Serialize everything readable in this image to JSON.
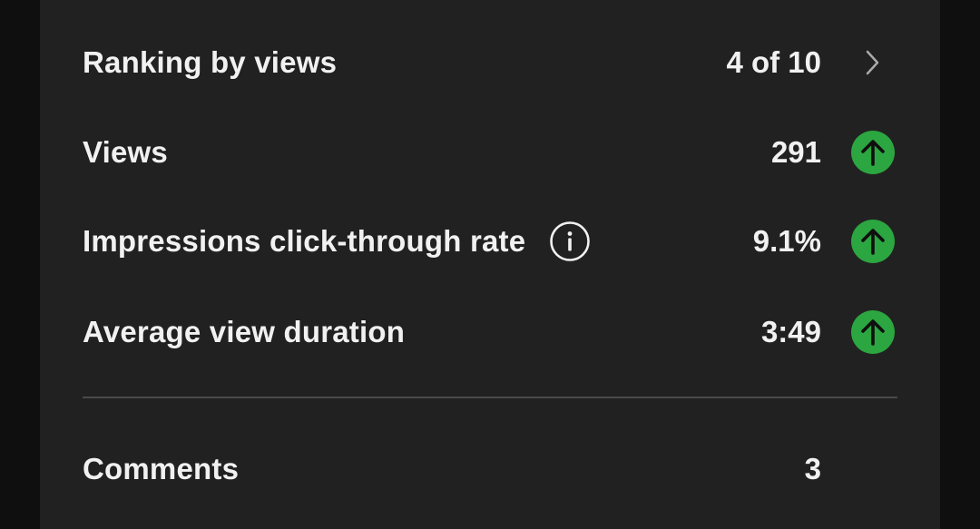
{
  "metrics": {
    "ranking": {
      "label": "Ranking by views",
      "value": "4 of 10",
      "icon": "chevron-right-icon"
    },
    "views": {
      "label": "Views",
      "value": "291",
      "trend_icon": "arrow-up-icon"
    },
    "ctr": {
      "label": "Impressions click-through rate",
      "value": "9.1%",
      "info_icon": "info-icon",
      "trend_icon": "arrow-up-icon"
    },
    "avg_duration": {
      "label": "Average view duration",
      "value": "3:49",
      "trend_icon": "arrow-up-icon"
    }
  },
  "engagement": {
    "comments": {
      "label": "Comments",
      "value": "3"
    }
  },
  "colors": {
    "background": "#212121",
    "outer_background": "#0f0f0f",
    "text": "#f1f1f1",
    "trend_up": "#2ba640",
    "divider": "#4a4a4a"
  }
}
